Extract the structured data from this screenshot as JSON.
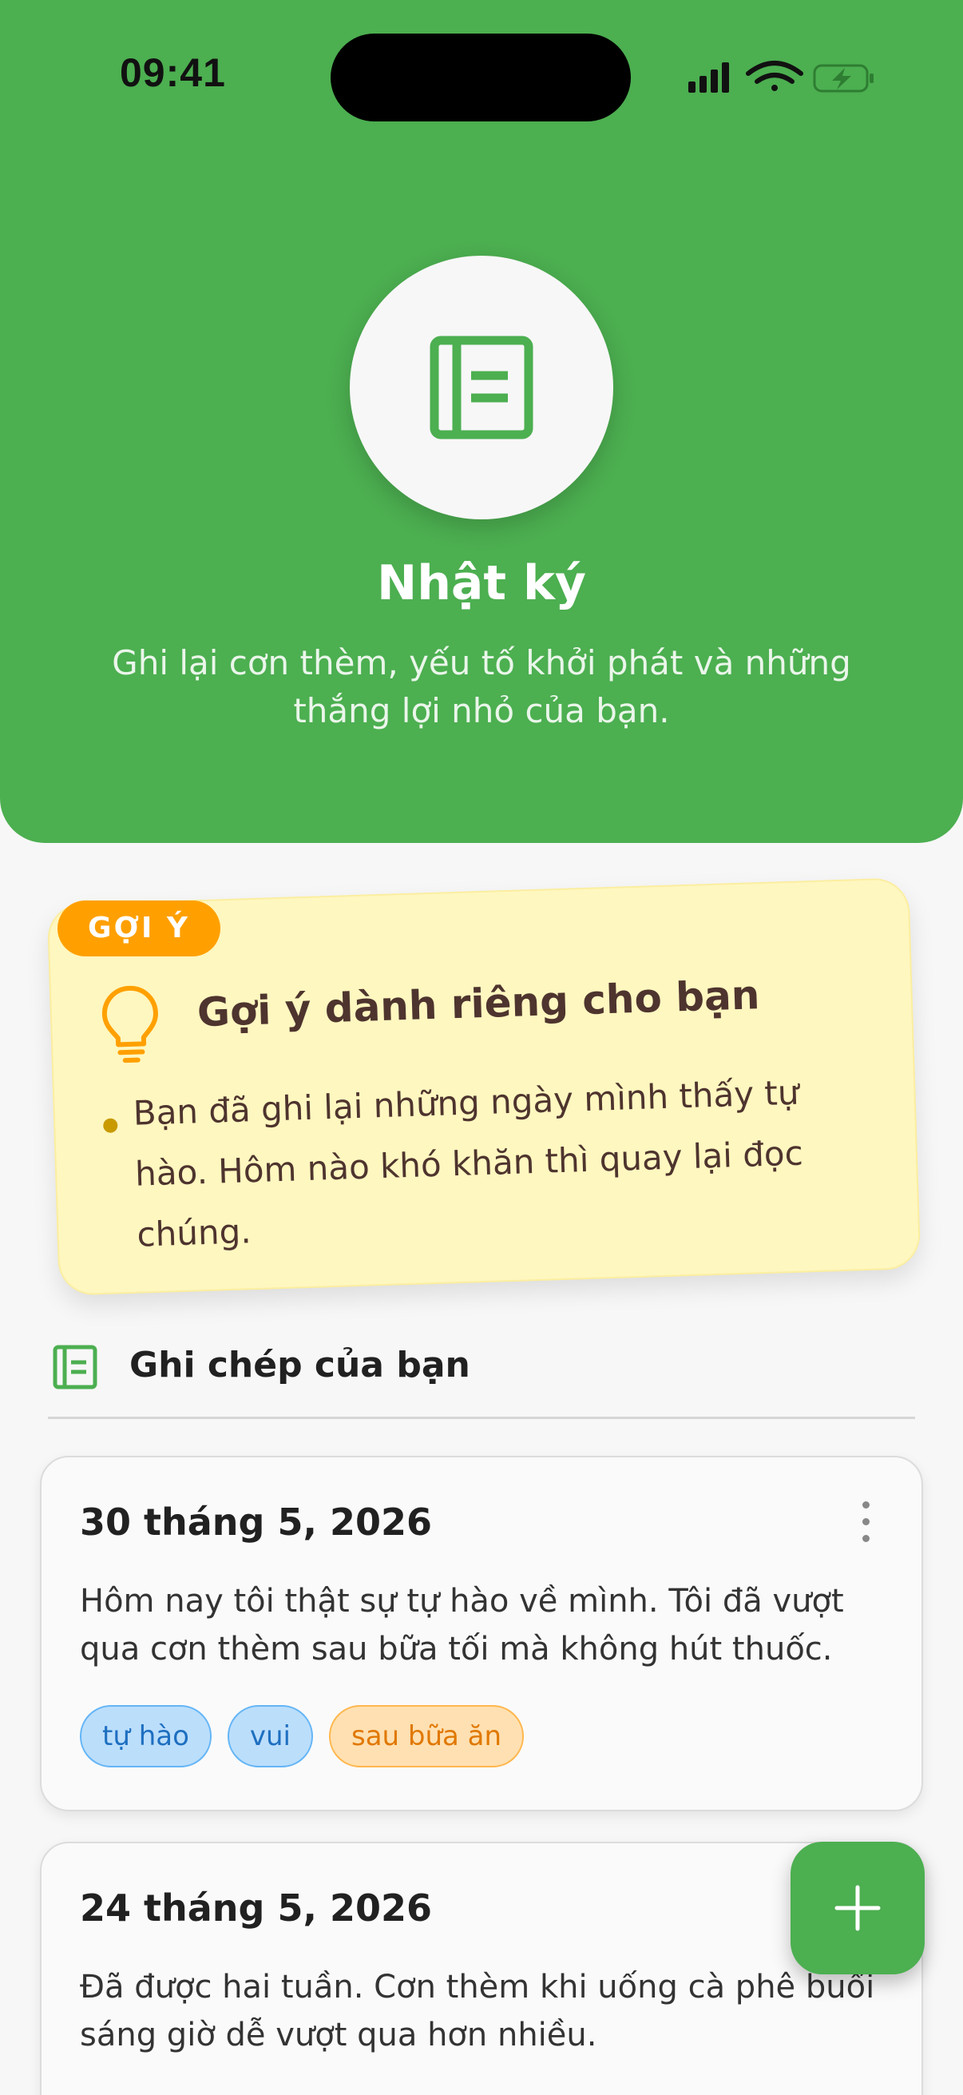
{
  "status_bar": {
    "time": "09:41"
  },
  "header": {
    "icon": "journal-icon",
    "title": "Nhật ký",
    "subtitle": "Ghi lại cơn thèm, yếu tố khởi phát và những thắng lợi nhỏ của bạn.",
    "color": "#4caf50"
  },
  "tip": {
    "badge": "GỢI Ý",
    "icon": "lightbulb-icon",
    "title": "Gợi ý dành riêng cho bạn",
    "bullet": "Bạn đã ghi lại những ngày mình thấy tự hào. Hôm nào khó khăn thì quay lại đọc chúng."
  },
  "section": {
    "icon": "journal-icon",
    "title": "Ghi chép của bạn"
  },
  "entries": [
    {
      "date": "30 tháng 5, 2026",
      "text": "Hôm nay tôi thật sự tự hào về mình. Tôi đã vượt qua cơn thèm sau bữa tối mà không hút thuốc.",
      "tags": [
        {
          "label": "tự hào",
          "color": "blue"
        },
        {
          "label": "vui",
          "color": "blue"
        },
        {
          "label": "sau bữa ăn",
          "color": "orange"
        }
      ]
    },
    {
      "date": "24 tháng 5, 2026",
      "text": "Đã được hai tuần. Cơn thèm khi uống cà phê buổi sáng giờ dễ vượt qua hơn nhiều."
    }
  ],
  "fab": {
    "icon": "plus-icon"
  }
}
